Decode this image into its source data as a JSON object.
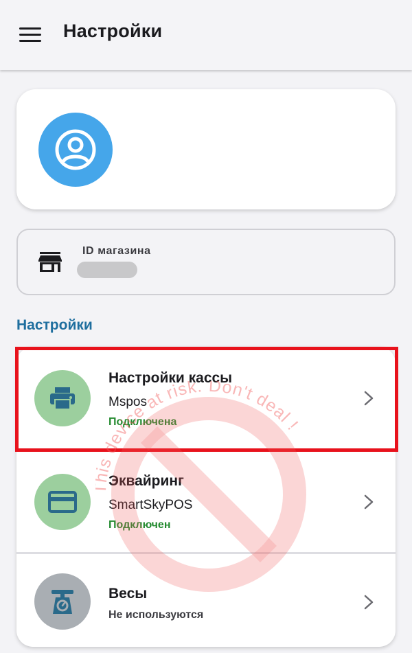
{
  "app_bar": {
    "title": "Настройки",
    "menu_icon": "hamburger-menu-icon"
  },
  "profile": {
    "avatar_icon": "account-circle-icon",
    "avatar_color": "#45a6ea"
  },
  "store": {
    "icon": "storefront-icon",
    "label": "ID магазина",
    "value_redacted": true
  },
  "section": {
    "title": "Настройки",
    "color": "#1e6e9e"
  },
  "settings_items": [
    {
      "icon": "printer-icon",
      "title": "Настройки кассы",
      "subtitle": "Mspos",
      "status": "Подключена",
      "status_color": "#238a2f",
      "icon_bg": "#9ccf9e",
      "highlighted": true
    },
    {
      "icon": "credit-card-icon",
      "title": "Эквайринг",
      "subtitle": "SmartSkyPOS",
      "status": "Подключен",
      "status_color": "#238a2f",
      "icon_bg": "#9ccf9e"
    },
    {
      "icon": "scale-icon",
      "title": "Весы",
      "subtitle": "",
      "status": "Не используются",
      "status_color": "#3b3b40",
      "icon_bg": "#a9aeb3"
    }
  ],
  "watermark": {
    "text": "This device at risk. Don't deal ! ",
    "color": "#f05a5a"
  },
  "highlight_color": "#e8121c"
}
